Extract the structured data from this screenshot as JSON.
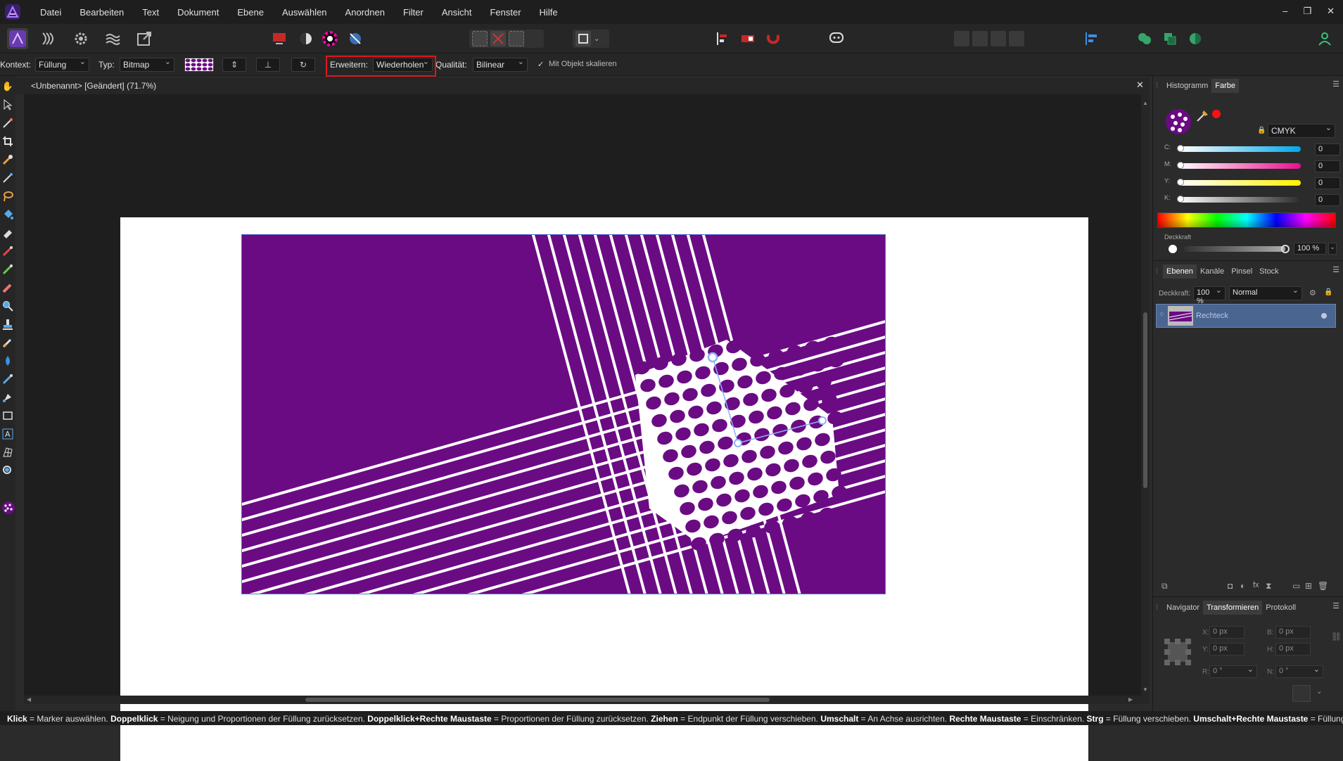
{
  "menu": [
    "Datei",
    "Bearbeiten",
    "Text",
    "Dokument",
    "Ebene",
    "Auswählen",
    "Anordnen",
    "Filter",
    "Ansicht",
    "Fenster",
    "Hilfe"
  ],
  "window_controls": [
    "–",
    "❐",
    "✕"
  ],
  "context_bar": {
    "context_label": "Kontext:",
    "context_value": "Füllung",
    "type_label": "Typ:",
    "type_value": "Bitmap",
    "extend_label": "Erweitern:",
    "extend_value": "Wiederholen",
    "quality_label": "Qualität:",
    "quality_value": "Bilinear",
    "scale_checkbox": "Mit Objekt skalieren",
    "scale_checked": true
  },
  "document": {
    "tab_title": "<Unbenannt> [Geändert] (71.7%)",
    "fill_color": "#6b0b84",
    "page_color": "#ffffff"
  },
  "right_panel": {
    "top_tabs": [
      "Histogramm",
      "Farbe"
    ],
    "color_model": "CMYK",
    "cmyk": [
      {
        "label": "C:",
        "value": "0"
      },
      {
        "label": "M:",
        "value": "0"
      },
      {
        "label": "Y:",
        "value": "0"
      },
      {
        "label": "K:",
        "value": "0"
      }
    ],
    "opacity_label": "Deckkraft",
    "opacity_value": "100 %",
    "layer_tabs": [
      "Ebenen",
      "Kanäle",
      "Pinsel",
      "Stock"
    ],
    "layer_opacity_label": "Deckkraft:",
    "layer_opacity_value": "100 %",
    "blend_mode": "Normal",
    "layer_name": "Rechteck",
    "bottom_tabs": [
      "Navigator",
      "Transformieren",
      "Protokoll"
    ],
    "transform": {
      "x_label": "X:",
      "x_value": "0 px",
      "y_label": "Y:",
      "y_value": "0 px",
      "b_label": "B:",
      "b_value": "0 px",
      "h_label": "H:",
      "h_value": "0 px",
      "r_label": "R:",
      "r_value": "0 °",
      "n_label": "N:",
      "n_value": "0 °"
    }
  },
  "status": {
    "parts": [
      {
        "k": "Klick",
        "v": " = Marker auswählen. "
      },
      {
        "k": "Doppelklick",
        "v": " = Neigung und Proportionen der Füllung zurücksetzen. "
      },
      {
        "k": "Doppelklick+Rechte Maustaste",
        "v": " = Proportionen der Füllung zurücksetzen. "
      },
      {
        "k": "Ziehen",
        "v": " = Endpunkt der Füllung verschieben. "
      },
      {
        "k": "Umschalt",
        "v": " = An Achse ausrichten. "
      },
      {
        "k": "Rechte Maustaste",
        "v": " = Einschränken. "
      },
      {
        "k": "Strg",
        "v": " = Füllung verschieben. "
      },
      {
        "k": "Umschalt+Rechte Maustaste",
        "v": " = Füllung verschieben."
      }
    ]
  },
  "colors": {
    "accent": "#8a3ff0",
    "highlight": "#e0141e",
    "layer_selected": "#4a6590",
    "handle": "#8ab0ff"
  }
}
